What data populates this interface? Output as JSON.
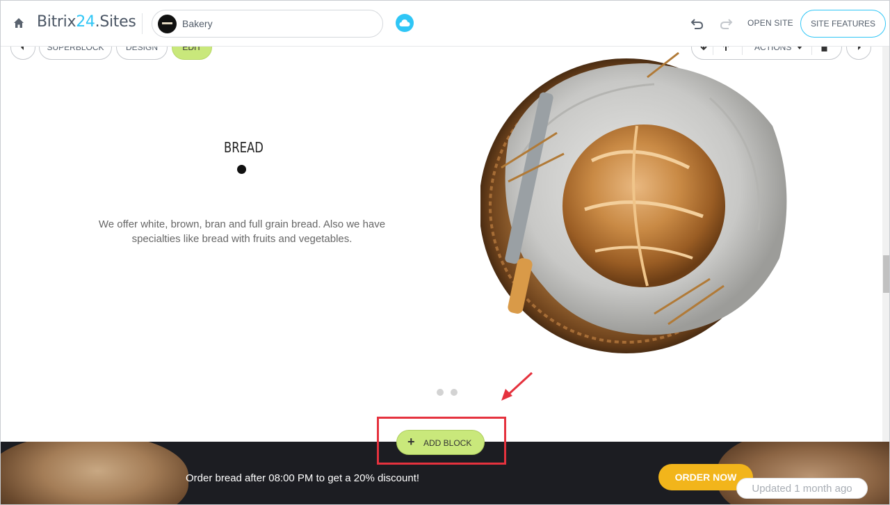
{
  "topbar": {
    "app_name_part1": "Bitrix",
    "app_name_num": "24",
    "app_name_part2": ".Sites",
    "site_name": "Bakery",
    "open_site": "OPEN SITE",
    "site_features": "SITE FEATURES",
    "icons": [
      "home-icon",
      "cloud-icon",
      "undo-icon",
      "redo-icon"
    ]
  },
  "block_toolbar": {
    "superblock": "SUPERBLOCK",
    "design": "DESIGN",
    "edit": "EDIT",
    "actions": "ACTIONS"
  },
  "content": {
    "heading": "BREAD",
    "description": "We offer white, brown, bran and full grain bread. Also we have specialties like bread with fruits and vegetables."
  },
  "add_block": {
    "label": "ADD BLOCK"
  },
  "banner": {
    "text": "Order bread after 08:00 PM to get a 20% discount!",
    "button": "ORDER NOW"
  },
  "status": {
    "updated": "Updated 1 month ago"
  },
  "colors": {
    "accent": "#2fc6f6",
    "edit_green": "#c9e87b",
    "highlight_red": "#e5323e",
    "order_yellow": "#f2b51b",
    "banner_dark": "#1c1d22"
  }
}
